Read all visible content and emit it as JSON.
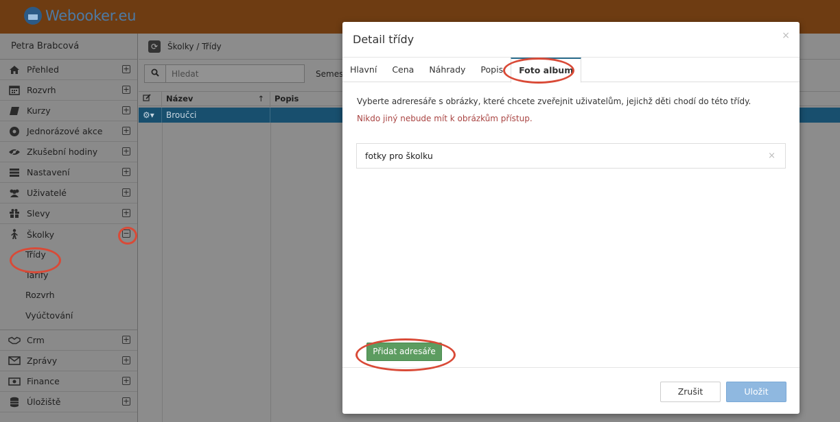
{
  "app": {
    "logo_text": "Webooker.eu",
    "logo_icon": "calendar-icon"
  },
  "sidebar": {
    "user_name": "Petra Brabcová",
    "items": [
      {
        "label": "Přehled",
        "icon": "home-icon"
      },
      {
        "label": "Rozvrh",
        "icon": "calendar-icon"
      },
      {
        "label": "Kurzy",
        "icon": "book-icon"
      },
      {
        "label": "Jednorázové akce",
        "icon": "ball-icon"
      },
      {
        "label": "Zkušební hodiny",
        "icon": "eye-icon"
      },
      {
        "label": "Nastavení",
        "icon": "settings-icon"
      },
      {
        "label": "Uživatelé",
        "icon": "users-icon"
      },
      {
        "label": "Slevy",
        "icon": "gift-icon"
      },
      {
        "label": "Školky",
        "icon": "child-icon"
      }
    ],
    "sub_items": [
      "Třídy",
      "Tarify",
      "Rozvrh",
      "Vyúčtování"
    ],
    "bottom_items": [
      {
        "label": "Crm",
        "icon": "handshake-icon"
      },
      {
        "label": "Zprávy",
        "icon": "mail-icon"
      },
      {
        "label": "Finance",
        "icon": "money-icon"
      },
      {
        "label": "Úložiště",
        "icon": "database-icon"
      }
    ]
  },
  "content": {
    "breadcrumb": "Školky / Třídy",
    "search_placeholder": "Hledat",
    "semester_label": "Semest",
    "columns": [
      "Název",
      "Popis"
    ],
    "rows": [
      {
        "name": "Broučci",
        "desc": ""
      }
    ]
  },
  "modal": {
    "title": "Detail třídy",
    "close": "×",
    "tabs": [
      "Hlavní",
      "Cena",
      "Náhrady",
      "Popis",
      "Foto album"
    ],
    "active_tab": "Foto album",
    "description": "Vyberte adreresáře s obrázky, které chcete zveřejnit uživatelům, jejichž děti chodí do této třídy.",
    "warning": "Nikdo jiný nebude mít k obrázkům přístup.",
    "directories": [
      "fotky pro školku"
    ],
    "remove_symbol": "×",
    "add_button": "Přidat adresáře",
    "cancel_button": "Zrušit",
    "save_button": "Uložit"
  },
  "colors": {
    "topbar": "#6e3c12",
    "selected_row": "#184f6e",
    "add_button": "#5c9c60",
    "save_button": "#8fb8e0",
    "warning_text": "#a94442",
    "annotation_circle": "#d94a37"
  }
}
